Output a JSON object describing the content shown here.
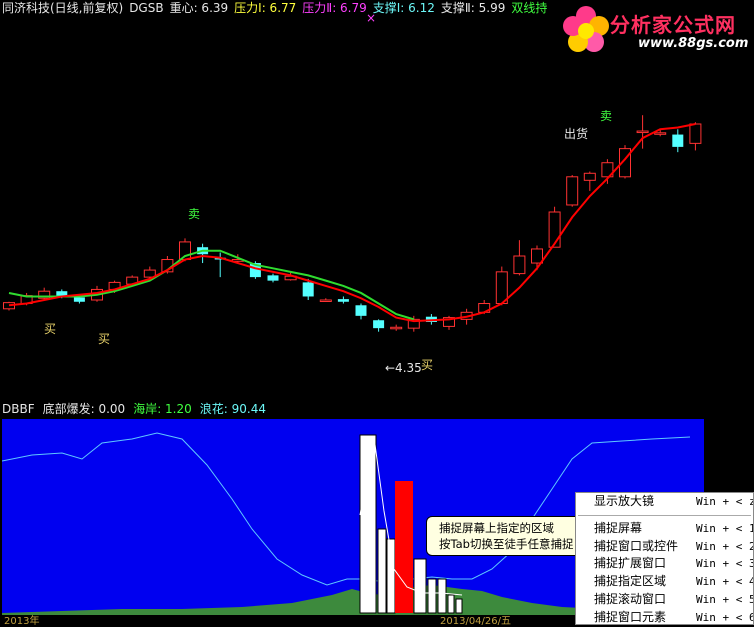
{
  "legend": {
    "stock": "同济科技(日线,前复权)",
    "indicator": "DGSB",
    "zhongxin": "重心: 6.39",
    "yali1": "压力Ⅰ: 6.77",
    "yali2": "压力Ⅱ: 6.79",
    "zhicheng1": "支撑Ⅰ: 6.12",
    "zhicheng2": "支撑Ⅱ: 5.99",
    "shuangxian": "双线持"
  },
  "logo": {
    "title": "分析家公式网",
    "url": "www.88gs.com"
  },
  "chart_labels": {
    "sell1": "卖",
    "sell2": "卖",
    "buy1": "买",
    "buy2": "买",
    "buy3": "买",
    "chuhuo": "出货",
    "low_marker": "←4.35",
    "x_mark": "×"
  },
  "lower_legend": {
    "name": "DBBF",
    "dibu": "底部爆发: 0.00",
    "haian": "海岸: 1.20",
    "langhua": "浪花: 90.44"
  },
  "tooltip": {
    "line1": "捕捉屏幕上指定的区域",
    "line2": "按Tab切换至徒手任意捕捉"
  },
  "menu": {
    "items": [
      {
        "label": "显示放大镜",
        "hotkey": "Win + < z"
      },
      {
        "label": "捕捉屏幕",
        "hotkey": "Win + < 1"
      },
      {
        "label": "捕捉窗口或控件",
        "hotkey": "Win + < 2"
      },
      {
        "label": "捕捉扩展窗口",
        "hotkey": "Win + < 3"
      },
      {
        "label": "捕捉指定区域",
        "hotkey": "Win + < 4"
      },
      {
        "label": "捕捉滚动窗口",
        "hotkey": "Win + < 5"
      },
      {
        "label": "捕捉窗口元素",
        "hotkey": "Win + < 6"
      }
    ]
  },
  "status": {
    "left": "2013年",
    "right": "2013/04/26/五"
  },
  "colors": {
    "up": "#ff3232",
    "down": "#54ffff",
    "red_line": "#ff0000",
    "green_line": "#2fdc2f",
    "panel_bg": "#0000f0",
    "cyan_line": "#5fc8ff"
  },
  "chart_data": {
    "type": "candlestick",
    "candles": [
      [
        5.6,
        5.67,
        5.58,
        5.68
      ],
      [
        5.66,
        5.75,
        5.64,
        5.78
      ],
      [
        5.72,
        5.8,
        5.7,
        5.84
      ],
      [
        5.8,
        5.74,
        5.72,
        5.82
      ],
      [
        5.73,
        5.68,
        5.66,
        5.75
      ],
      [
        5.7,
        5.82,
        5.68,
        5.86
      ],
      [
        5.82,
        5.9,
        5.78,
        5.92
      ],
      [
        5.88,
        5.96,
        5.86,
        5.98
      ],
      [
        5.96,
        6.04,
        5.92,
        6.08
      ],
      [
        6.02,
        6.16,
        6.0,
        6.2
      ],
      [
        6.16,
        6.36,
        6.14,
        6.4
      ],
      [
        6.3,
        6.22,
        6.12,
        6.34
      ],
      [
        6.18,
        6.16,
        5.96,
        6.24
      ],
      [
        6.14,
        6.16,
        6.12,
        6.22
      ],
      [
        6.12,
        5.96,
        5.94,
        6.14
      ],
      [
        5.98,
        5.92,
        5.9,
        6.0
      ],
      [
        5.93,
        5.97,
        5.92,
        6.02
      ],
      [
        5.9,
        5.74,
        5.7,
        5.94
      ],
      [
        5.7,
        5.7,
        5.68,
        5.72
      ],
      [
        5.71,
        5.68,
        5.66,
        5.74
      ],
      [
        5.64,
        5.52,
        5.48,
        5.66
      ],
      [
        5.47,
        5.38,
        5.34,
        5.48
      ],
      [
        5.39,
        5.39,
        5.35,
        5.42
      ],
      [
        5.38,
        5.48,
        5.34,
        5.52
      ],
      [
        5.51,
        5.45,
        5.42,
        5.54
      ],
      [
        5.4,
        5.5,
        5.36,
        5.52
      ],
      [
        5.48,
        5.56,
        5.42,
        5.6
      ],
      [
        5.56,
        5.66,
        5.54,
        5.7
      ],
      [
        5.66,
        6.02,
        5.64,
        6.08
      ],
      [
        6.0,
        6.2,
        5.98,
        6.38
      ],
      [
        6.12,
        6.28,
        6.04,
        6.32
      ],
      [
        6.3,
        6.7,
        6.3,
        6.76
      ],
      [
        6.78,
        7.1,
        6.76,
        7.12
      ],
      [
        7.06,
        7.14,
        6.94,
        7.16
      ],
      [
        7.1,
        7.26,
        7.02,
        7.3
      ],
      [
        7.1,
        7.42,
        7.08,
        7.46
      ],
      [
        7.62,
        7.62,
        7.42,
        7.8
      ],
      [
        7.6,
        7.6,
        7.56,
        7.64
      ],
      [
        7.58,
        7.44,
        7.38,
        7.64
      ],
      [
        7.48,
        7.7,
        7.4,
        7.72
      ]
    ],
    "red_line": [
      5.64,
      5.66,
      5.7,
      5.74,
      5.76,
      5.78,
      5.82,
      5.88,
      5.94,
      6.04,
      6.16,
      6.2,
      6.18,
      6.12,
      6.06,
      6.02,
      5.98,
      5.92,
      5.86,
      5.8,
      5.72,
      5.62,
      5.5,
      5.46,
      5.47,
      5.48,
      5.51,
      5.56,
      5.66,
      5.84,
      6.06,
      6.34,
      6.64,
      6.88,
      7.08,
      7.3,
      7.54,
      7.64,
      7.66,
      7.7
    ],
    "green_line": [
      5.78,
      5.74,
      5.74,
      5.74,
      5.74,
      5.76,
      5.8,
      5.86,
      5.92,
      6.04,
      6.2,
      6.26,
      6.26,
      6.18,
      6.1,
      6.06,
      6.02,
      5.98,
      5.92,
      5.86,
      5.78,
      5.66,
      5.54,
      5.48
    ]
  }
}
